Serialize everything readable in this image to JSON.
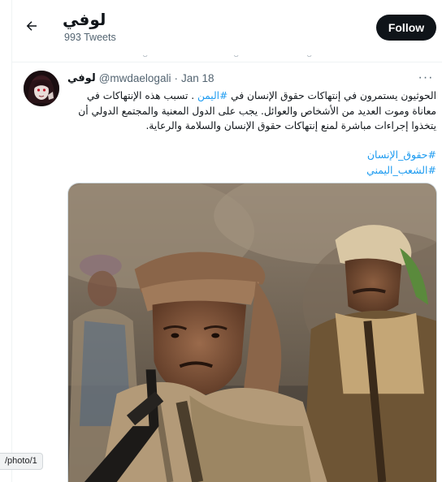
{
  "header": {
    "title": "لوفي",
    "tweet_count": "993 Tweets",
    "follow_label": "Follow"
  },
  "tweet": {
    "display_name": "لوفي",
    "handle": "@mwdaelogali",
    "separator": "·",
    "date": "Jan 18",
    "more_label": "···",
    "text_part1": "الحوثيون يستمرون في إنتهاكات حقوق الإنسان في ",
    "text_link": "#اليمن",
    "text_part2": " . تسبب هذه الإنتهاكات في معاناة وموت العديد من الأشخاص والعوائل. يجب على الدول المعنية والمجتمع الدولي أن يتخذوا إجراءات مباشرة لمنع إنتهاكات حقوق الإنسان والسلامة والرعاية.",
    "hashtags": [
      "#حقوق_الإنسان",
      "#الشعب_اليمني"
    ]
  },
  "status_bar": {
    "url": "/photo/1"
  },
  "colors": {
    "accent": "#1d9bf0",
    "follow_bg": "#0f1419",
    "muted_text": "#536471"
  }
}
